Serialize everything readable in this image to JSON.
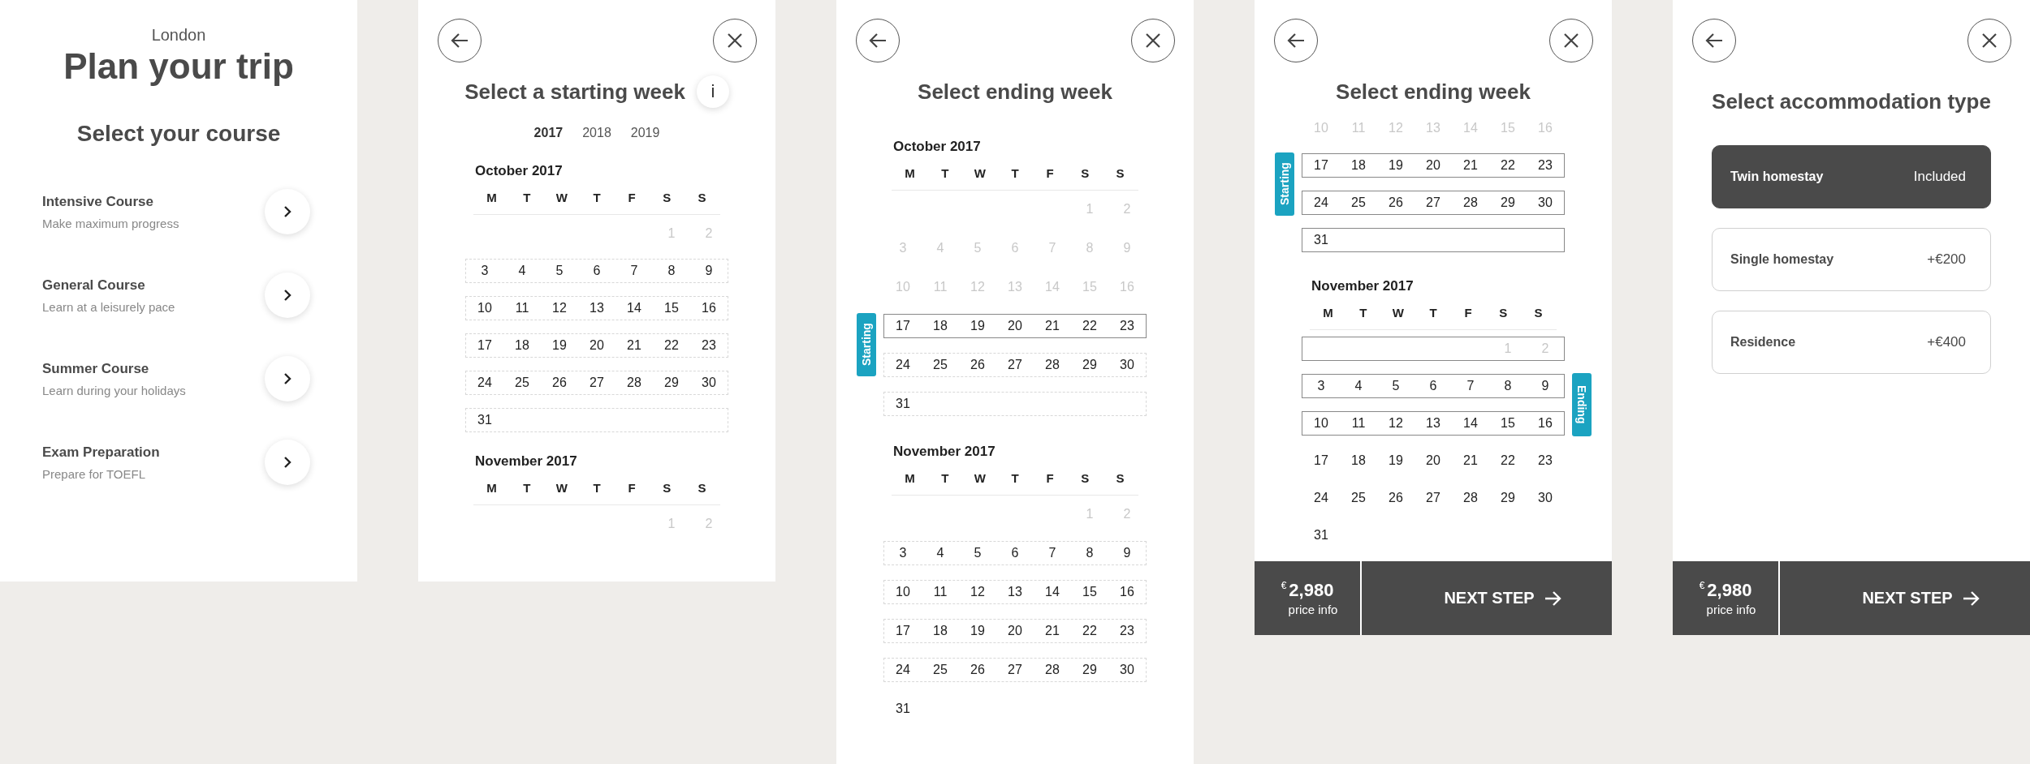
{
  "screens": [
    {
      "kind": "courses",
      "city": "London",
      "title": "Plan your trip",
      "subtitle": "Select your course",
      "courses": [
        {
          "name": "Intensive Course",
          "description": "Make maximum progress"
        },
        {
          "name": "General Course",
          "description": "Learn at a leisurely pace"
        },
        {
          "name": "Summer Course",
          "description": "Learn during your holidays"
        },
        {
          "name": "Exam Preparation",
          "description": "Prepare for TOEFL"
        }
      ]
    },
    {
      "kind": "calendar",
      "title": "Select a starting week",
      "info_label": "i",
      "years": [
        {
          "label": "2017",
          "selected": true
        },
        {
          "label": "2018",
          "selected": false
        },
        {
          "label": "2019",
          "selected": false
        }
      ],
      "months": [
        {
          "name": "October 2017",
          "weekdays": [
            "M",
            "T",
            "W",
            "T",
            "F",
            "S",
            "S"
          ],
          "first_week": {
            "kind": "plain",
            "disabled": true,
            "days": [
              "1",
              "2"
            ]
          },
          "weeks": [
            {
              "kind": "dashed",
              "disabled": false,
              "days": [
                "3",
                "4",
                "5",
                "6",
                "7",
                "8",
                "9"
              ]
            },
            {
              "kind": "dashed",
              "disabled": false,
              "days": [
                "10",
                "11",
                "12",
                "13",
                "14",
                "15",
                "16"
              ]
            },
            {
              "kind": "dashed",
              "disabled": false,
              "days": [
                "17",
                "18",
                "19",
                "20",
                "21",
                "22",
                "23"
              ]
            },
            {
              "kind": "dashed",
              "disabled": false,
              "days": [
                "24",
                "25",
                "26",
                "27",
                "28",
                "29",
                "30"
              ]
            },
            {
              "kind": "dashed",
              "disabled": false,
              "days": [
                "31"
              ]
            }
          ]
        },
        {
          "name": "November 2017",
          "weekdays": [
            "M",
            "T",
            "W",
            "T",
            "F",
            "S",
            "S"
          ],
          "first_week": {
            "kind": "plain",
            "disabled": true,
            "days": [
              "1",
              "2"
            ]
          }
        }
      ]
    },
    {
      "kind": "calendar",
      "title": "Select ending week",
      "months": [
        {
          "name": "October 2017",
          "weekdays": [
            "M",
            "T",
            "W",
            "T",
            "F",
            "S",
            "S"
          ],
          "first_week": {
            "kind": "plain",
            "disabled": true,
            "days": [
              "1",
              "2"
            ]
          },
          "weeks": [
            {
              "kind": "plain",
              "disabled": true,
              "days": [
                "3",
                "4",
                "5",
                "6",
                "7",
                "8",
                "9"
              ]
            },
            {
              "kind": "plain",
              "disabled": true,
              "days": [
                "10",
                "11",
                "12",
                "13",
                "14",
                "15",
                "16"
              ]
            },
            {
              "kind": "solid",
              "disabled": false,
              "days": [
                "17",
                "18",
                "19",
                "20",
                "21",
                "22",
                "23"
              ],
              "tag": {
                "label": "Starting",
                "kind": "start"
              }
            },
            {
              "kind": "dashed",
              "disabled": false,
              "days": [
                "24",
                "25",
                "26",
                "27",
                "28",
                "29",
                "30"
              ]
            },
            {
              "kind": "dashed",
              "disabled": false,
              "days": [
                "31"
              ]
            }
          ]
        },
        {
          "name": "November 2017",
          "weekdays": [
            "M",
            "T",
            "W",
            "T",
            "F",
            "S",
            "S"
          ],
          "first_week": {
            "kind": "plain",
            "disabled": true,
            "days": [
              "1",
              "2"
            ]
          },
          "weeks": [
            {
              "kind": "dashed",
              "disabled": false,
              "days": [
                "3",
                "4",
                "5",
                "6",
                "7",
                "8",
                "9"
              ]
            },
            {
              "kind": "dashed",
              "disabled": false,
              "days": [
                "10",
                "11",
                "12",
                "13",
                "14",
                "15",
                "16"
              ]
            },
            {
              "kind": "dashed",
              "disabled": false,
              "days": [
                "17",
                "18",
                "19",
                "20",
                "21",
                "22",
                "23"
              ]
            },
            {
              "kind": "dashed",
              "disabled": false,
              "days": [
                "24",
                "25",
                "26",
                "27",
                "28",
                "29",
                "30"
              ]
            },
            {
              "kind": "plain",
              "disabled": false,
              "days": [
                "31"
              ]
            }
          ]
        }
      ]
    },
    {
      "kind": "calendar",
      "title": "Select ending week",
      "months": [
        {
          "weeks": [
            {
              "kind": "plain",
              "disabled": true,
              "days": [
                "10",
                "11",
                "12",
                "13",
                "14",
                "15",
                "16"
              ]
            },
            {
              "kind": "solid",
              "disabled": false,
              "days": [
                "17",
                "18",
                "19",
                "20",
                "21",
                "22",
                "23"
              ],
              "tag": {
                "label": "Starting",
                "kind": "start"
              }
            },
            {
              "kind": "solid",
              "disabled": false,
              "days": [
                "24",
                "25",
                "26",
                "27",
                "28",
                "29",
                "30"
              ]
            },
            {
              "kind": "solid",
              "disabled": false,
              "days": [
                "31"
              ]
            }
          ]
        },
        {
          "name": "November 2017",
          "weekdays": [
            "M",
            "T",
            "W",
            "T",
            "F",
            "S",
            "S"
          ],
          "first_week": {
            "kind": "solid",
            "disabled": true,
            "days": [
              "1",
              "2"
            ]
          },
          "weeks": [
            {
              "kind": "solid",
              "disabled": false,
              "days": [
                "3",
                "4",
                "5",
                "6",
                "7",
                "8",
                "9"
              ]
            },
            {
              "kind": "solid",
              "disabled": false,
              "days": [
                "10",
                "11",
                "12",
                "13",
                "14",
                "15",
                "16"
              ],
              "tag": {
                "label": "Ending",
                "kind": "end"
              }
            },
            {
              "kind": "plain",
              "disabled": false,
              "days": [
                "17",
                "18",
                "19",
                "20",
                "21",
                "22",
                "23"
              ]
            },
            {
              "kind": "plain",
              "disabled": false,
              "days": [
                "24",
                "25",
                "26",
                "27",
                "28",
                "29",
                "30"
              ]
            },
            {
              "kind": "plain",
              "disabled": false,
              "days": [
                "31"
              ]
            }
          ]
        }
      ],
      "footer": {
        "currency": "€",
        "price": "2,980",
        "price_label": "price info",
        "next_label": "NEXT STEP"
      }
    },
    {
      "kind": "accommodation",
      "title": "Select accommodation type",
      "options": [
        {
          "name": "Twin homestay",
          "price": "Included",
          "selected": true
        },
        {
          "name": "Single homestay",
          "price": "+€200",
          "selected": false
        },
        {
          "name": "Residence",
          "price": "+€400",
          "selected": false
        }
      ],
      "footer": {
        "currency": "€",
        "price": "2,980",
        "price_label": "price info",
        "next_label": "NEXT STEP"
      }
    }
  ]
}
